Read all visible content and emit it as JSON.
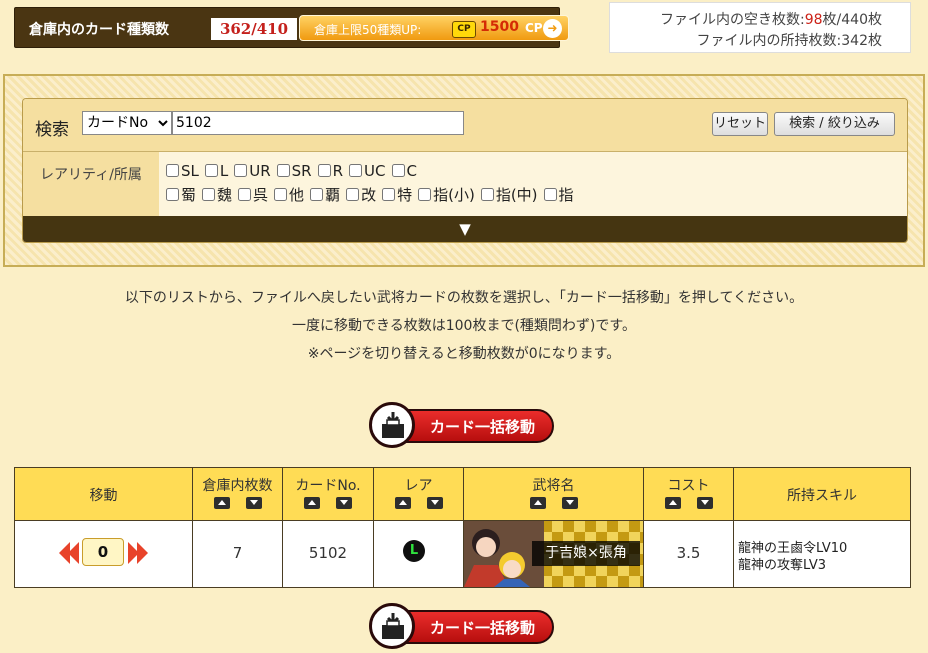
{
  "header": {
    "stock_label": "倉庫内のカード種類数",
    "stock_count": "362/410",
    "upgrade_label": "倉庫上限50種類UP:",
    "cp_badge": "CP",
    "cp_value": "1500",
    "cp_unit": "CP",
    "file_free_prefix": "ファイル内の空き枚数:",
    "file_free_value": "98",
    "file_free_suffix": "枚/440枚",
    "file_owned": "ファイル内の所持枚数:342枚"
  },
  "search": {
    "label": "検索",
    "sort_selected": "カードNo",
    "input_value": "5102",
    "reset_label": "リセット",
    "submit_label": "検索 / 絞り込み",
    "rarity_label": "レアリティ/所属",
    "rarity_options": [
      "SL",
      "L",
      "UR",
      "SR",
      "R",
      "UC",
      "C"
    ],
    "faction_options": [
      "蜀",
      "魏",
      "呉",
      "他",
      "覇",
      "改",
      "特",
      "指(小)",
      "指(中)",
      "指"
    ],
    "expand_icon": "▼"
  },
  "instructions": {
    "line1": "以下のリストから、ファイルへ戻したい武将カードの枚数を選択し、「カード一括移動」を押してください。",
    "line2": "一度に移動できる枚数は100枚まで(種類問わず)です。",
    "line3": "※ページを切り替えると移動枚数が0になります。"
  },
  "bulk_move_label": "カード一括移動",
  "table": {
    "headers": {
      "move": "移動",
      "stock": "倉庫内枚数",
      "card_no": "カードNo.",
      "rarity": "レア",
      "name": "武将名",
      "cost": "コスト",
      "skills": "所持スキル"
    },
    "rows": [
      {
        "move_count": "0",
        "stock": "7",
        "card_no": "5102",
        "rarity": "L",
        "name": "于吉娘×張角",
        "cost": "3.5",
        "skills": [
          "龍神の王鹵令LV10",
          "龍神の攻奪LV3"
        ]
      }
    ]
  },
  "colors": {
    "page_bg": "#fbefc6",
    "header_yellow": "#ffdc55",
    "bulk_red": "#d41f1f",
    "dark_bar": "#453511",
    "accent_red": "#cc2218"
  }
}
